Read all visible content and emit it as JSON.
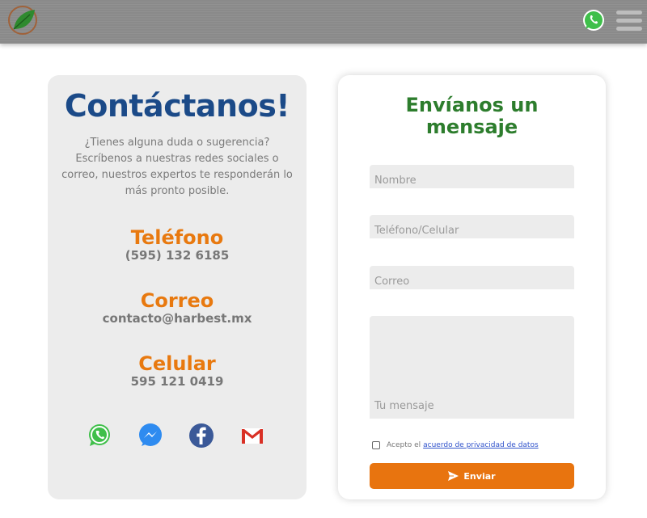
{
  "header": {
    "logo_icon": "leaf-logo-icon",
    "whatsapp_icon": "whatsapp-icon",
    "menu_icon": "hamburger-menu-icon"
  },
  "contact_card": {
    "title": "Contáctanos!",
    "description": "¿Tienes alguna duda o sugerencia? Escríbenos a nuestras redes sociales o correo, nuestros expertos te responderán lo más pronto posible.",
    "phone_heading": "Teléfono",
    "phone_value": "(595) 132 6185",
    "email_heading": "Correo",
    "email_value": "contacto@harbest.mx",
    "mobile_heading": "Celular",
    "mobile_value": "595 121 0419",
    "socials": [
      "whatsapp-icon",
      "messenger-icon",
      "facebook-icon",
      "gmail-icon"
    ]
  },
  "form": {
    "title": "Envíanos un mensaje",
    "name_placeholder": "Nombre",
    "phone_placeholder": "Teléfono/Celular",
    "email_placeholder": "Correo",
    "message_placeholder": "Tu mensaje",
    "consent_prefix": "Acepto el",
    "consent_link": "acuerdo de privacidad de datos",
    "submit_label": "Enviar"
  },
  "colors": {
    "topbar": "#8a8a8a",
    "title_blue": "#1b4a88",
    "accent_orange": "#e8790f",
    "form_title_green": "#2d7d2d"
  }
}
